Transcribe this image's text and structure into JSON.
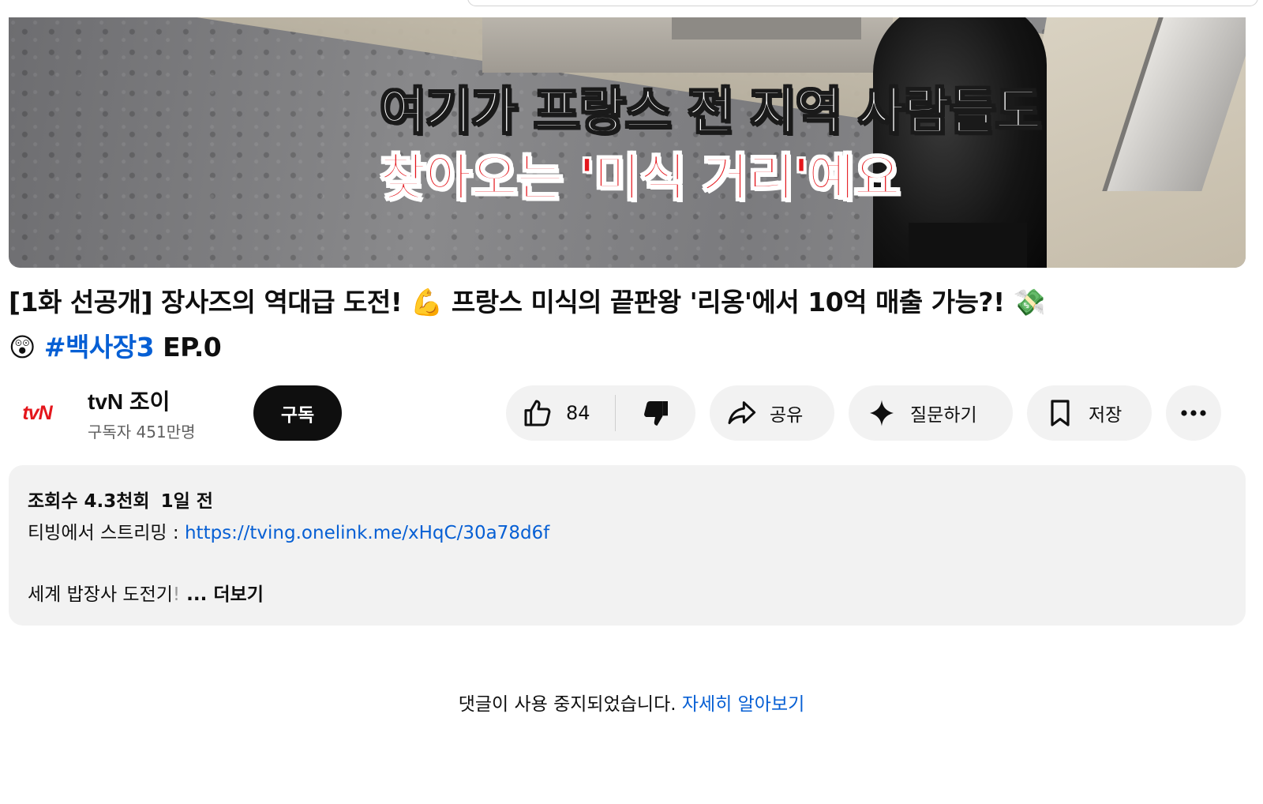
{
  "video": {
    "caption_line1": "여기가 프랑스 전 지역 사람들도",
    "caption_line2": "찾아오는 '미식 거리'예요"
  },
  "title": {
    "part1": "[1화 선공개] 장사즈의 역대급 도전! ",
    "emoji_muscle": "💪",
    "part2": " 프랑스 미식의 끝판왕 '리옹'에서 10억 매출 가능?! ",
    "emoji_money": "💸",
    "emoji_shock": "😲",
    "hashtag": "#백사장3",
    "part3": " EP.0"
  },
  "channel": {
    "logo_text": "tvN",
    "name": "tvN 조이",
    "subscribers": "구독자 451만명",
    "subscribe_label": "구독"
  },
  "actions": {
    "like_count": "84",
    "share_label": "공유",
    "ask_label": "질문하기",
    "save_label": "저장"
  },
  "description": {
    "views": "조회수 4.3천회",
    "date": "1일 전",
    "stream_prefix": "티빙에서 스트리밍 : ",
    "stream_link": "https://tving.onelink.me/xHqC/30a78d6f",
    "line3_text": "세계 밥장사 도전기",
    "line3_fade": "!",
    "ellipsis": " ... ",
    "more_label": "더보기"
  },
  "comments": {
    "disabled_text": "댓글이 사용 중지되었습니다. ",
    "learn_more": "자세히 알아보기"
  },
  "colors": {
    "link_blue": "#065fd4",
    "pill_bg": "#f2f2f2",
    "subscribe_bg": "#0f0f0f",
    "tvn_red": "#e4161c"
  },
  "icons": [
    "like-icon",
    "dislike-icon",
    "share-icon",
    "sparkle-icon",
    "bookmark-icon",
    "more-icon"
  ]
}
